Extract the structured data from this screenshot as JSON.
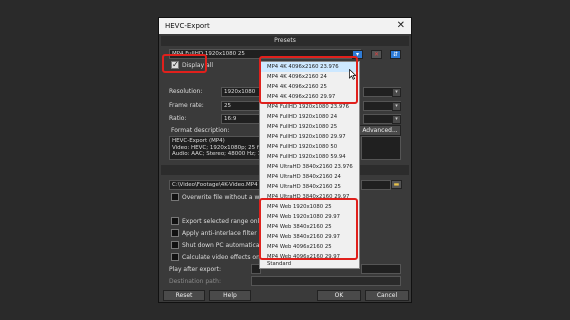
{
  "dialog": {
    "title": "HEVC-Export",
    "close_glyph": "✕"
  },
  "presets": {
    "header": "Presets",
    "selected_value": "MP4 FullHD 1920x1080 25",
    "display_all_label": "Display all"
  },
  "settings": {
    "resolution_label": "Resolution:",
    "resolution_value": "1920x1080",
    "framerate_label": "Frame rate:",
    "framerate_value": "25",
    "ratio_label": "Ratio:",
    "ratio_value": "16:9",
    "format_desc_label": "Format description:",
    "advanced_label": "Advanced...",
    "format_desc_lines": [
      "HEVC-Export (MP4)",
      "Video: HEVC; 1920x1080p; 25 frames",
      "Audio: AAC; Stereo; 48000 Hz; 192 kbps"
    ]
  },
  "file": {
    "header": "File n",
    "path": "C:\\Video\\Footage\\4K-Video.MP4",
    "overwrite_label": "Overwrite file without a warnin"
  },
  "options": [
    "Export selected range only",
    "Apply anti-interlace filter (supp",
    "Shut down PC automatically a",
    "Calculate video effects on GPU"
  ],
  "after_export": {
    "label": "Play after export:",
    "dest_label": "Destination path:"
  },
  "buttons": {
    "reset": "Reset",
    "help": "Help",
    "ok": "OK",
    "cancel": "Cancel"
  },
  "dropdown_items": [
    "MP4 4K 4096x2160 23.976",
    "MP4 4K 4096x2160 24",
    "MP4 4K 4096x2160 25",
    "MP4 4K 4096x2160 29.97",
    "MP4 FullHD 1920x1080 23.976",
    "MP4 FullHD 1920x1080 24",
    "MP4 FullHD 1920x1080 25",
    "MP4 FullHD 1920x1080 29.97",
    "MP4 FullHD 1920x1080 50",
    "MP4 FullHD 1920x1080 59.94",
    "MP4 UltraHD 3840x2160 23.976",
    "MP4 UltraHD 3840x2160 24",
    "MP4 UltraHD 3840x2160 25",
    "MP4 UltraHD 3840x2160 29.97",
    "MP4 Web 1920x1080 25",
    "MP4 Web 1920x1080 29.97",
    "MP4 Web 3840x2160 25",
    "MP4 Web 3840x2160 29.97",
    "MP4 Web 4096x2160 25",
    "MP4 Web 4096x2160 29.97",
    "Standard"
  ],
  "colors": {
    "highlight": "#e0201c",
    "dialog_bg": "#3a3a3a",
    "selection": "#cde8ff"
  },
  "icons": [
    "close-icon",
    "dropdown-arrow-icon",
    "delete-preset-icon",
    "save-preset-icon",
    "folder-icon",
    "checkmark-icon",
    "mouse-cursor-icon"
  ]
}
